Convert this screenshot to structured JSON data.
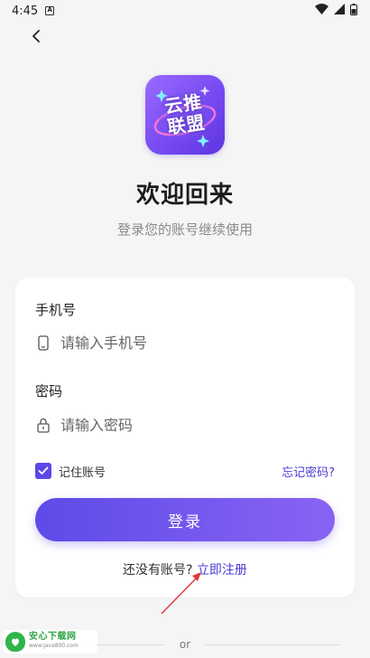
{
  "status_bar": {
    "time": "4:45"
  },
  "header": {
    "title": "欢迎回来",
    "subtitle": "登录您的账号继续使用"
  },
  "logo": {
    "line1": "云推",
    "line2": "联盟"
  },
  "form": {
    "phone_label": "手机号",
    "phone_placeholder": "请输入手机号",
    "password_label": "密码",
    "password_placeholder": "请输入密码",
    "remember_label": "记住账号",
    "remember_checked": true,
    "forgot_label": "忘记密码?",
    "login_label": "登录",
    "no_account_text": "还没有账号? ",
    "register_label": "立即注册"
  },
  "footer": {
    "or_text": "or"
  },
  "watermark": {
    "main": "安心下载网",
    "url": "www.java800.com"
  },
  "colors": {
    "accent": "#5b48e6",
    "link": "#4a3bd6",
    "background": "#f5f5f6"
  },
  "icons": [
    "back-arrow-icon",
    "phone-icon",
    "lock-icon",
    "check-icon",
    "wifi-icon",
    "signal-icon",
    "battery-icon"
  ]
}
